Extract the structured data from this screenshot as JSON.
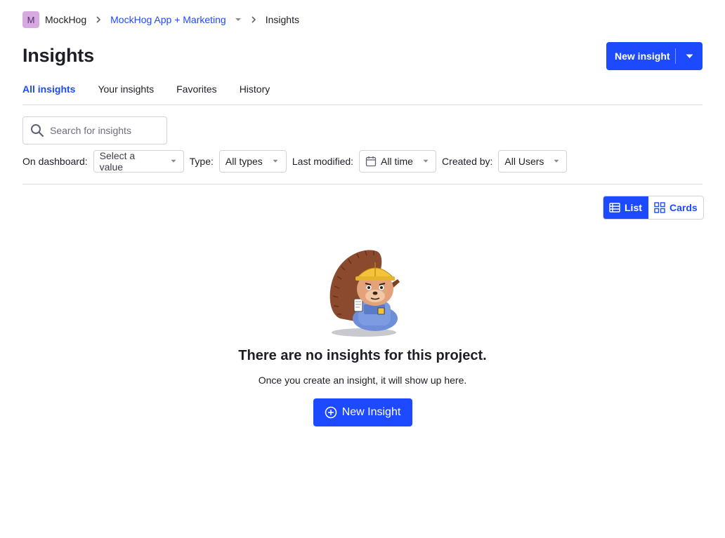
{
  "breadcrumbs": {
    "org_initial": "M",
    "org_name": "MockHog",
    "project_name": "MockHog App + Marketing",
    "current": "Insights"
  },
  "header": {
    "title": "Insights",
    "new_insight_label": "New insight"
  },
  "tabs": [
    {
      "label": "All insights",
      "active": true
    },
    {
      "label": "Your insights",
      "active": false
    },
    {
      "label": "Favorites",
      "active": false
    },
    {
      "label": "History",
      "active": false
    }
  ],
  "search": {
    "placeholder": "Search for insights",
    "value": ""
  },
  "filters": {
    "dashboard_label": "On dashboard:",
    "dashboard_value": "Select a value",
    "type_label": "Type:",
    "type_value": "All types",
    "modified_label": "Last modified:",
    "modified_value": "All time",
    "created_label": "Created by:",
    "created_value": "All Users"
  },
  "view_toggle": {
    "list_label": "List",
    "cards_label": "Cards",
    "selected": "List"
  },
  "empty_state": {
    "title": "There are no insights for this project.",
    "description": "Once you create an insight, it will show up here.",
    "button_label": "New Insight"
  },
  "colors": {
    "primary": "#1d4aff",
    "border": "#d2d3d9",
    "avatar_bg": "#d6a9e0",
    "text": "#1d1f27"
  }
}
